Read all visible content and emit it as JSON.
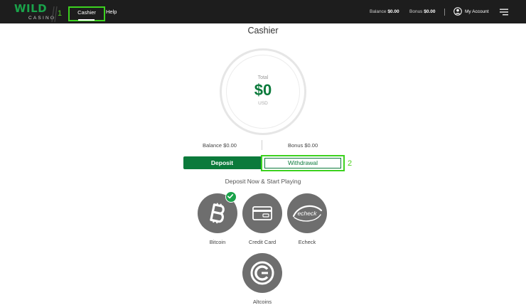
{
  "topbar": {
    "logo_word": "WILD",
    "logo_sub": "CASINO",
    "nav": {
      "cashier": "Cashier",
      "help": "Help"
    },
    "balance_label": "Balance",
    "balance_value": "$0.00",
    "bonus_label": "Bonus",
    "bonus_value": "$0.00",
    "account_label": "My Account"
  },
  "annotations": {
    "one": "1",
    "two": "2"
  },
  "cashier": {
    "title": "Cashier",
    "total_label": "Total",
    "total_amount": "$0",
    "total_currency": "USD",
    "balance_line": "Balance $0.00",
    "bonus_line": "Bonus $0.00",
    "tabs": {
      "deposit": "Deposit",
      "withdrawal": "Withdrawal"
    },
    "subtitle": "Deposit Now & Start Playing",
    "methods": [
      {
        "label": "Bitcoin",
        "icon": "bitcoin-icon",
        "selected": true
      },
      {
        "label": "Credit Card",
        "icon": "credit-card-icon",
        "selected": false
      },
      {
        "label": "Echeck",
        "icon": "echeck-icon",
        "icon_text": "echeck",
        "selected": false
      },
      {
        "label": "Altcoins",
        "icon": "altcoins-icon",
        "selected": false
      }
    ]
  },
  "colors": {
    "brand_green": "#0b7a3b",
    "annotation_green": "#3cd21f",
    "topbar": "#1d1d1d",
    "method_circle": "#6e6e6e"
  }
}
